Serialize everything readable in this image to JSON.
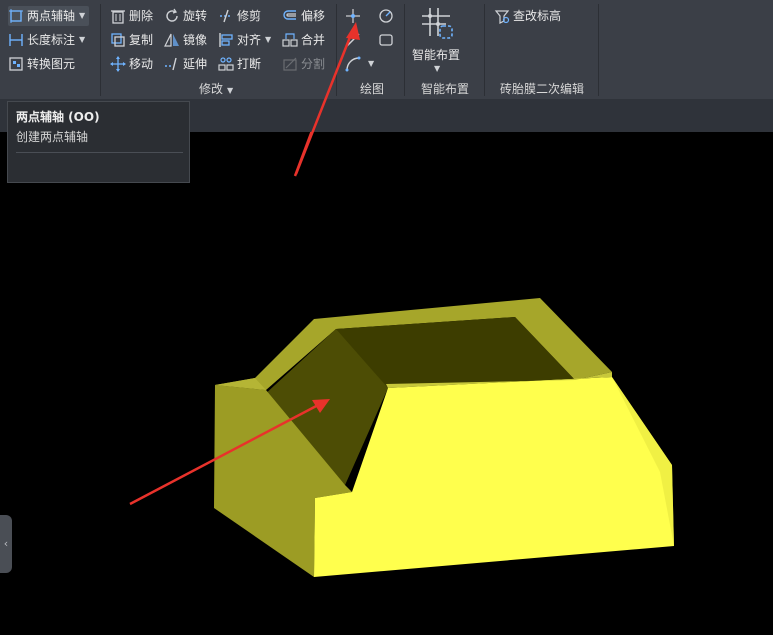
{
  "ribbon": {
    "col1": [
      {
        "label": "两点辅轴",
        "icon": "axis-two-points-icon",
        "has_dropdown": true,
        "selected": true
      },
      {
        "label": "长度标注",
        "icon": "length-dimension-icon",
        "has_dropdown": true
      },
      {
        "label": "转换图元",
        "icon": "convert-element-icon",
        "has_dropdown": false
      }
    ],
    "modify": {
      "group_label": "修改",
      "items": [
        {
          "label": "删除",
          "icon": "delete-icon"
        },
        {
          "label": "旋转",
          "icon": "rotate-icon"
        },
        {
          "label": "修剪",
          "icon": "trim-icon"
        },
        {
          "label": "偏移",
          "icon": "offset-icon"
        },
        {
          "label": "复制",
          "icon": "copy-icon"
        },
        {
          "label": "镜像",
          "icon": "mirror-icon"
        },
        {
          "label": "对齐",
          "icon": "align-icon",
          "has_dropdown": true
        },
        {
          "label": "合并",
          "icon": "merge-icon"
        },
        {
          "label": "移动",
          "icon": "move-icon"
        },
        {
          "label": "延伸",
          "icon": "extend-icon"
        },
        {
          "label": "打断",
          "icon": "break-icon"
        },
        {
          "label": "分割",
          "icon": "split-icon",
          "disabled": true
        }
      ]
    },
    "draw": {
      "group_label": "绘图"
    },
    "smart": {
      "button_label": "智能布置",
      "group_label": "智能布置"
    },
    "tire": {
      "button_label": "查改标高",
      "group_label": "砖胎膜二次编辑"
    }
  },
  "tooltip": {
    "title": "两点辅轴 (OO)",
    "description": "创建两点辅轴"
  },
  "colors": {
    "ribbon_bg": "#3b3f47",
    "model_yellow": "#ffff4d",
    "model_olive": "#9c9c24",
    "model_dark": "#3a3a00",
    "arrow_red": "#e8322b"
  }
}
